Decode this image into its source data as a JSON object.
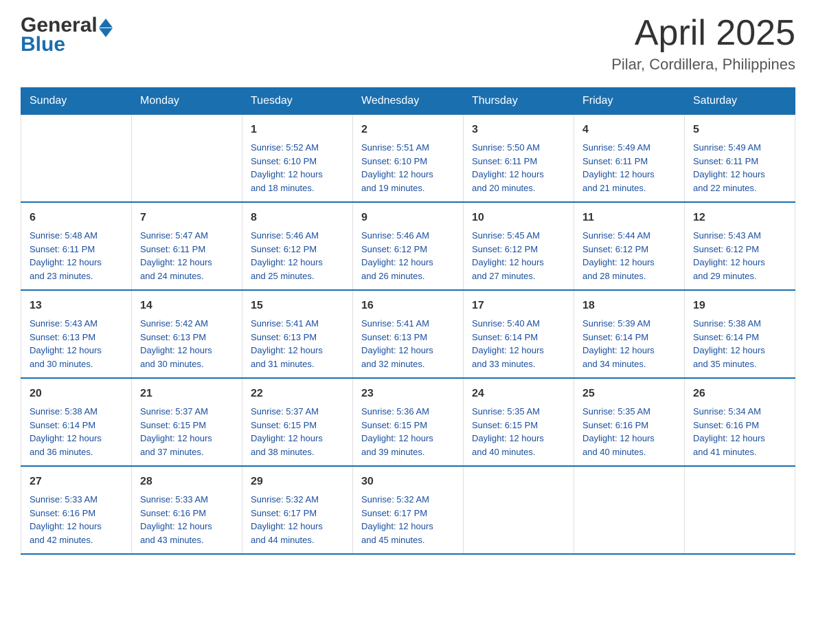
{
  "header": {
    "logo": {
      "general": "General",
      "blue": "Blue"
    },
    "title": "April 2025",
    "location": "Pilar, Cordillera, Philippines"
  },
  "weekdays": [
    "Sunday",
    "Monday",
    "Tuesday",
    "Wednesday",
    "Thursday",
    "Friday",
    "Saturday"
  ],
  "weeks": [
    [
      {
        "day": "",
        "info": ""
      },
      {
        "day": "",
        "info": ""
      },
      {
        "day": "1",
        "info": "Sunrise: 5:52 AM\nSunset: 6:10 PM\nDaylight: 12 hours\nand 18 minutes."
      },
      {
        "day": "2",
        "info": "Sunrise: 5:51 AM\nSunset: 6:10 PM\nDaylight: 12 hours\nand 19 minutes."
      },
      {
        "day": "3",
        "info": "Sunrise: 5:50 AM\nSunset: 6:11 PM\nDaylight: 12 hours\nand 20 minutes."
      },
      {
        "day": "4",
        "info": "Sunrise: 5:49 AM\nSunset: 6:11 PM\nDaylight: 12 hours\nand 21 minutes."
      },
      {
        "day": "5",
        "info": "Sunrise: 5:49 AM\nSunset: 6:11 PM\nDaylight: 12 hours\nand 22 minutes."
      }
    ],
    [
      {
        "day": "6",
        "info": "Sunrise: 5:48 AM\nSunset: 6:11 PM\nDaylight: 12 hours\nand 23 minutes."
      },
      {
        "day": "7",
        "info": "Sunrise: 5:47 AM\nSunset: 6:11 PM\nDaylight: 12 hours\nand 24 minutes."
      },
      {
        "day": "8",
        "info": "Sunrise: 5:46 AM\nSunset: 6:12 PM\nDaylight: 12 hours\nand 25 minutes."
      },
      {
        "day": "9",
        "info": "Sunrise: 5:46 AM\nSunset: 6:12 PM\nDaylight: 12 hours\nand 26 minutes."
      },
      {
        "day": "10",
        "info": "Sunrise: 5:45 AM\nSunset: 6:12 PM\nDaylight: 12 hours\nand 27 minutes."
      },
      {
        "day": "11",
        "info": "Sunrise: 5:44 AM\nSunset: 6:12 PM\nDaylight: 12 hours\nand 28 minutes."
      },
      {
        "day": "12",
        "info": "Sunrise: 5:43 AM\nSunset: 6:12 PM\nDaylight: 12 hours\nand 29 minutes."
      }
    ],
    [
      {
        "day": "13",
        "info": "Sunrise: 5:43 AM\nSunset: 6:13 PM\nDaylight: 12 hours\nand 30 minutes."
      },
      {
        "day": "14",
        "info": "Sunrise: 5:42 AM\nSunset: 6:13 PM\nDaylight: 12 hours\nand 30 minutes."
      },
      {
        "day": "15",
        "info": "Sunrise: 5:41 AM\nSunset: 6:13 PM\nDaylight: 12 hours\nand 31 minutes."
      },
      {
        "day": "16",
        "info": "Sunrise: 5:41 AM\nSunset: 6:13 PM\nDaylight: 12 hours\nand 32 minutes."
      },
      {
        "day": "17",
        "info": "Sunrise: 5:40 AM\nSunset: 6:14 PM\nDaylight: 12 hours\nand 33 minutes."
      },
      {
        "day": "18",
        "info": "Sunrise: 5:39 AM\nSunset: 6:14 PM\nDaylight: 12 hours\nand 34 minutes."
      },
      {
        "day": "19",
        "info": "Sunrise: 5:38 AM\nSunset: 6:14 PM\nDaylight: 12 hours\nand 35 minutes."
      }
    ],
    [
      {
        "day": "20",
        "info": "Sunrise: 5:38 AM\nSunset: 6:14 PM\nDaylight: 12 hours\nand 36 minutes."
      },
      {
        "day": "21",
        "info": "Sunrise: 5:37 AM\nSunset: 6:15 PM\nDaylight: 12 hours\nand 37 minutes."
      },
      {
        "day": "22",
        "info": "Sunrise: 5:37 AM\nSunset: 6:15 PM\nDaylight: 12 hours\nand 38 minutes."
      },
      {
        "day": "23",
        "info": "Sunrise: 5:36 AM\nSunset: 6:15 PM\nDaylight: 12 hours\nand 39 minutes."
      },
      {
        "day": "24",
        "info": "Sunrise: 5:35 AM\nSunset: 6:15 PM\nDaylight: 12 hours\nand 40 minutes."
      },
      {
        "day": "25",
        "info": "Sunrise: 5:35 AM\nSunset: 6:16 PM\nDaylight: 12 hours\nand 40 minutes."
      },
      {
        "day": "26",
        "info": "Sunrise: 5:34 AM\nSunset: 6:16 PM\nDaylight: 12 hours\nand 41 minutes."
      }
    ],
    [
      {
        "day": "27",
        "info": "Sunrise: 5:33 AM\nSunset: 6:16 PM\nDaylight: 12 hours\nand 42 minutes."
      },
      {
        "day": "28",
        "info": "Sunrise: 5:33 AM\nSunset: 6:16 PM\nDaylight: 12 hours\nand 43 minutes."
      },
      {
        "day": "29",
        "info": "Sunrise: 5:32 AM\nSunset: 6:17 PM\nDaylight: 12 hours\nand 44 minutes."
      },
      {
        "day": "30",
        "info": "Sunrise: 5:32 AM\nSunset: 6:17 PM\nDaylight: 12 hours\nand 45 minutes."
      },
      {
        "day": "",
        "info": ""
      },
      {
        "day": "",
        "info": ""
      },
      {
        "day": "",
        "info": ""
      }
    ]
  ]
}
